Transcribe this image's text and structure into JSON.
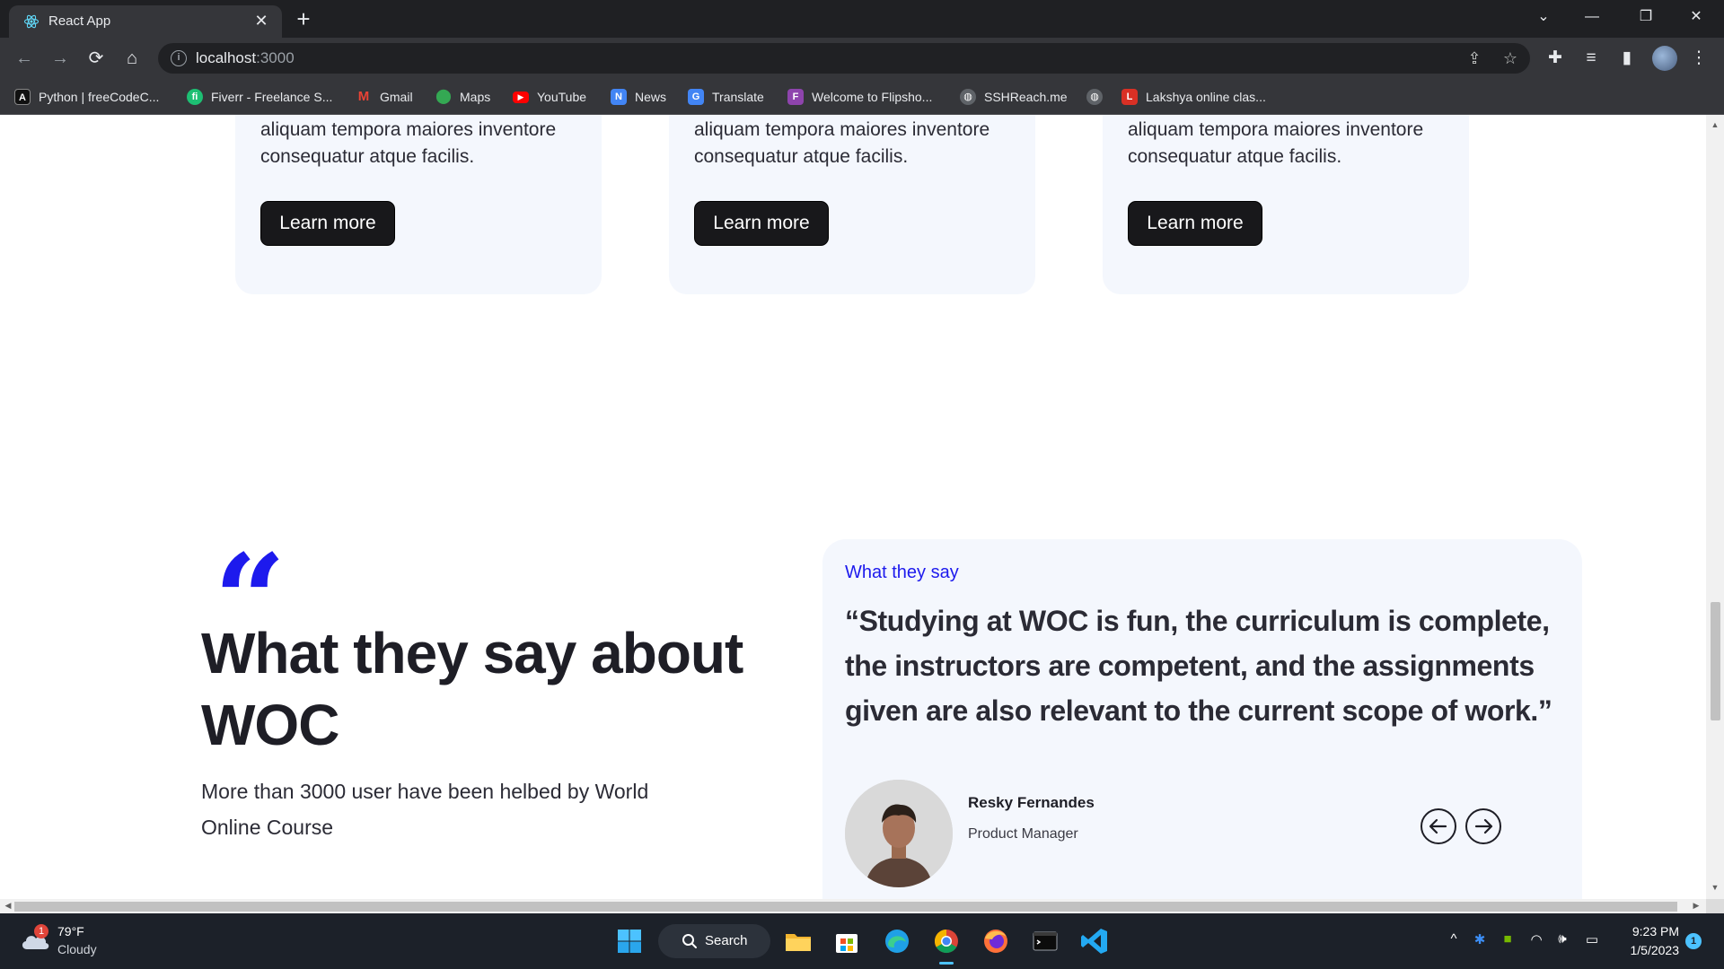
{
  "browser": {
    "tab_title": "React App",
    "url_host": "localhost",
    "url_port": ":3000",
    "bookmarks": [
      {
        "label": "Python | freeCodeC...",
        "icon": "freecodecamp-icon",
        "color": "#111111"
      },
      {
        "label": "Fiverr - Freelance S...",
        "icon": "fiverr-icon",
        "color": "#1dbf73"
      },
      {
        "label": "Gmail",
        "icon": "gmail-icon",
        "color": "#ea4335"
      },
      {
        "label": "Maps",
        "icon": "maps-icon",
        "color": "#34a853"
      },
      {
        "label": "YouTube",
        "icon": "youtube-icon",
        "color": "#ff0000"
      },
      {
        "label": "News",
        "icon": "news-icon",
        "color": "#4285f4"
      },
      {
        "label": "Translate",
        "icon": "translate-icon",
        "color": "#4285f4"
      },
      {
        "label": "Welcome to Flipsho...",
        "icon": "flipshope-icon",
        "color": "#8e44ad"
      },
      {
        "label": "SSHReach.me",
        "icon": "globe-icon",
        "color": "#5f6368"
      },
      {
        "label": "",
        "icon": "globe-icon",
        "color": "#5f6368"
      },
      {
        "label": "Lakshya online clas...",
        "icon": "lakshya-icon",
        "color": "#d93025"
      }
    ]
  },
  "cards": [
    {
      "text": "aliquam tempora maiores inventore consequatur atque facilis.",
      "button": "Learn more"
    },
    {
      "text": "aliquam tempora maiores inventore consequatur atque facilis.",
      "button": "Learn more"
    },
    {
      "text": "aliquam tempora maiores inventore consequatur atque facilis.",
      "button": "Learn more"
    }
  ],
  "testimonials_section": {
    "quote_glyph": "“",
    "headline": "What they say about WOC",
    "subline": "More than 3000 user have been helbed by World Online Course",
    "card": {
      "label": "What they say",
      "quote": "“Studying at WOC is fun, the curriculum is complete, the instructors are competent, and the assignments given are also relevant to the current scope of work.”",
      "name": "Resky Fernandes",
      "role": "Product Manager"
    }
  },
  "taskbar": {
    "weather_temp": "79°F",
    "weather_desc": "Cloudy",
    "weather_badge": "1",
    "search_label": "Search",
    "time": "9:23 PM",
    "date": "1/5/2023",
    "notification_count": "1"
  },
  "colors": {
    "accent": "#1d1aed",
    "card_bg": "#f4f7fd",
    "button_bg": "#18181b",
    "chrome_dark": "#1f2023",
    "chrome_toolbar": "#35363a",
    "taskbar": "#1c2129"
  }
}
